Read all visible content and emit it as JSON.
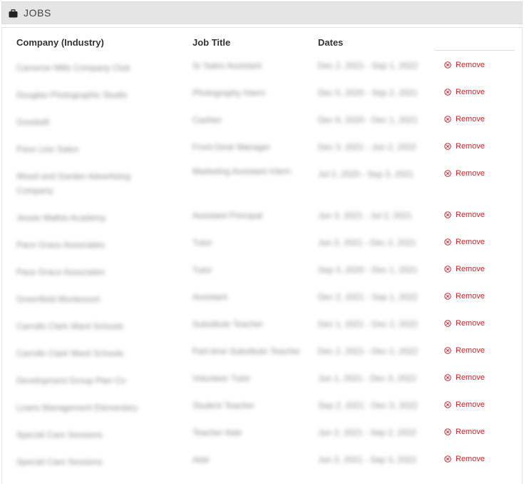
{
  "panel": {
    "title": "JOBS",
    "icon": "briefcase-icon"
  },
  "table": {
    "headers": {
      "company": "Company (Industry)",
      "title": "Job Title",
      "dates": "Dates"
    },
    "remove_label": "Remove",
    "remove_color": "#d2232a",
    "rows": [
      {
        "company": "Cameron Mills Company Club",
        "title": "Sr Sales Assistant",
        "dates": "Dec 2, 2021 - Sep 1, 2022"
      },
      {
        "company": "Douglas Photographic Studio",
        "title": "Photography Intern",
        "dates": "Dec 5, 2020 - Sep 2, 2021"
      },
      {
        "company": "Goodwill",
        "title": "Cashier",
        "dates": "Dec 6, 2020 - Dec 1, 2021"
      },
      {
        "company": "Pace Line Salon",
        "title": "Front Desk Manager",
        "dates": "Dec 3, 2021 - Jun 2, 2022"
      },
      {
        "company": "Wood and Garden Advertising Company",
        "title": "Marketing Assistant Intern",
        "dates": "Jul 2, 2020 - Sep 3, 2021"
      },
      {
        "company": "Jessie Mathis Academy",
        "title": "Assistant Principal",
        "dates": "Jun 3, 2021 - Jul 2, 2021"
      },
      {
        "company": "Pace Grace Associates",
        "title": "Tutor",
        "dates": "Jun 3, 2021 - Dec 2, 2021"
      },
      {
        "company": "Pace Grace Associates",
        "title": "Tutor",
        "dates": "Sep 3, 2020 - Dec 1, 2021"
      },
      {
        "company": "Greenfield Montessori",
        "title": "Assistant",
        "dates": "Dec 2, 2021 - Sep 1, 2022"
      },
      {
        "company": "Carrolls Clark Ward Schools",
        "title": "Substitute Teacher",
        "dates": "Dec 1, 2021 - Dec 2, 2022"
      },
      {
        "company": "Carrolls Clark Ward Schools",
        "title": "Part-time Substitute Teacher",
        "dates": "Dec 2, 2021 - Dec 2, 2022"
      },
      {
        "company": "Development Group Plan Co",
        "title": "Volunteer Tutor",
        "dates": "Jun 1, 2021 - Dec 3, 2022"
      },
      {
        "company": "Loans Management Elementary",
        "title": "Student Teacher",
        "dates": "Sep 2, 2021 - Dec 3, 2022"
      },
      {
        "company": "Special Care Sessions",
        "title": "Teacher Aide",
        "dates": "Jun 2, 2021 - Sep 2, 2022"
      },
      {
        "company": "Special Care Sessions",
        "title": "Aide",
        "dates": "Jun 3, 2021 - Sep 3, 2022"
      }
    ]
  }
}
